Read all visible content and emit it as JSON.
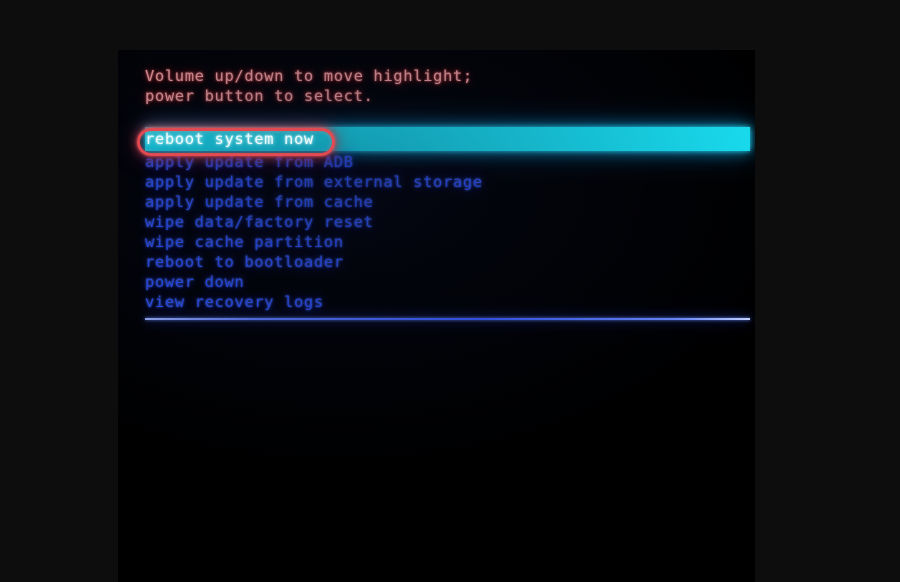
{
  "screen": {
    "kind": "android-recovery-mode",
    "background_color": "#000000",
    "outer_background_color": "#0d0d0d"
  },
  "instructions": {
    "line1": "Volume up/down to move highlight;",
    "line2": "power button to select.",
    "color": "#f4a3a3"
  },
  "menu": {
    "selected_index": 0,
    "highlight_color": "#19e3f5",
    "selected_text_color": "#eafcff",
    "item_color": "#2f54ff",
    "items": [
      {
        "label": "reboot system now"
      },
      {
        "label": "apply update from ADB"
      },
      {
        "label": "apply update from external storage"
      },
      {
        "label": "apply update from cache"
      },
      {
        "label": "wipe data/factory reset"
      },
      {
        "label": "wipe cache partition"
      },
      {
        "label": "reboot to bootloader"
      },
      {
        "label": "power down"
      },
      {
        "label": "view recovery logs"
      }
    ]
  },
  "annotation": {
    "target_label": "reboot system now",
    "shape": "rounded-rectangle",
    "color": "#e24a52"
  },
  "divider": {
    "color": "#3a5cff"
  }
}
